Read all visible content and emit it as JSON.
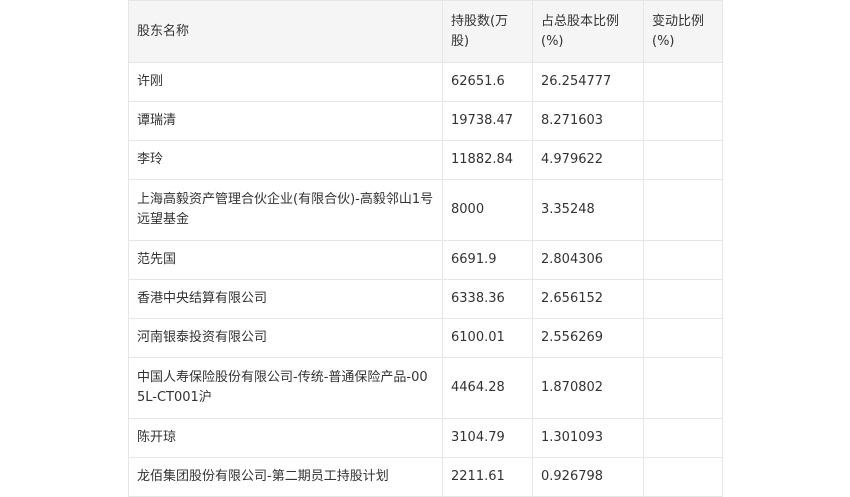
{
  "table": {
    "headers": [
      "股东名称",
      "持股数(万股)",
      "占总股本比例(%)",
      "变动比例(%)"
    ],
    "rows": [
      {
        "name": "许刚",
        "shares": "62651.6",
        "ratio": "26.254777",
        "change": ""
      },
      {
        "name": "谭瑞清",
        "shares": "19738.47",
        "ratio": "8.271603",
        "change": ""
      },
      {
        "name": "李玲",
        "shares": "11882.84",
        "ratio": "4.979622",
        "change": ""
      },
      {
        "name": "上海高毅资产管理合伙企业(有限合伙)-高毅邻山1号远望基金",
        "shares": "8000",
        "ratio": "3.35248",
        "change": ""
      },
      {
        "name": "范先国",
        "shares": "6691.9",
        "ratio": "2.804306",
        "change": ""
      },
      {
        "name": "香港中央结算有限公司",
        "shares": "6338.36",
        "ratio": "2.656152",
        "change": ""
      },
      {
        "name": "河南银泰投资有限公司",
        "shares": "6100.01",
        "ratio": "2.556269",
        "change": ""
      },
      {
        "name": "中国人寿保险股份有限公司-传统-普通保险产品-005L-CT001沪",
        "shares": "4464.28",
        "ratio": "1.870802",
        "change": ""
      },
      {
        "name": "陈开琼",
        "shares": "3104.79",
        "ratio": "1.301093",
        "change": ""
      },
      {
        "name": "龙佰集团股份有限公司-第二期员工持股计划",
        "shares": "2211.61",
        "ratio": "0.926798",
        "change": ""
      }
    ]
  }
}
